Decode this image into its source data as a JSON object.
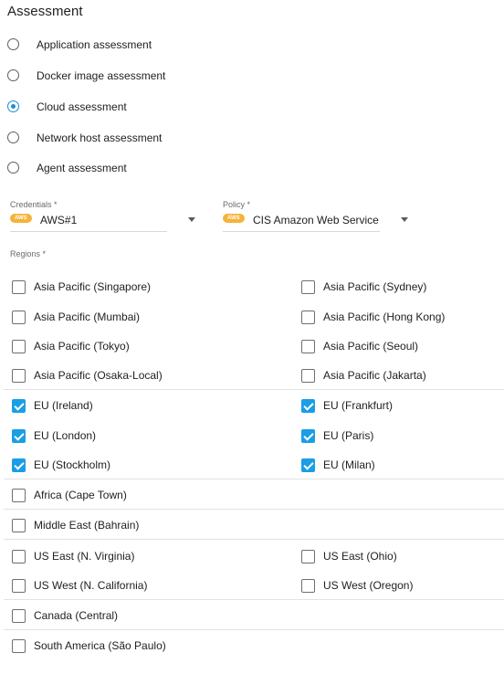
{
  "title": "Assessment",
  "assessment_types": [
    {
      "label": "Application assessment",
      "selected": false
    },
    {
      "label": "Docker image assessment",
      "selected": false
    },
    {
      "label": "Cloud assessment",
      "selected": true
    },
    {
      "label": "Network host assessment",
      "selected": false
    },
    {
      "label": "Agent assessment",
      "selected": false
    }
  ],
  "credentials": {
    "label": "Credentials *",
    "badge": "AWS",
    "value": "AWS#1"
  },
  "policy": {
    "label": "Policy *",
    "badge": "AWS",
    "value": "CIS Amazon Web Services"
  },
  "regions": {
    "label": "Regions *",
    "items": [
      {
        "label": "Asia Pacific (Singapore)",
        "checked": false
      },
      {
        "label": "Asia Pacific (Sydney)",
        "checked": false
      },
      {
        "label": "Asia Pacific (Mumbai)",
        "checked": false
      },
      {
        "label": "Asia Pacific (Hong Kong)",
        "checked": false
      },
      {
        "label": "Asia Pacific (Tokyo)",
        "checked": false
      },
      {
        "label": "Asia Pacific (Seoul)",
        "checked": false
      },
      {
        "label": "Asia Pacific (Osaka-Local)",
        "checked": false
      },
      {
        "label": "Asia Pacific (Jakarta)",
        "checked": false
      },
      {
        "label": "EU (Ireland)",
        "checked": true
      },
      {
        "label": "EU (Frankfurt)",
        "checked": true
      },
      {
        "label": "EU (London)",
        "checked": true
      },
      {
        "label": "EU (Paris)",
        "checked": true
      },
      {
        "label": "EU (Stockholm)",
        "checked": true
      },
      {
        "label": "EU (Milan)",
        "checked": true
      },
      {
        "label": "Africa (Cape Town)",
        "checked": false
      },
      {
        "label": "Middle East (Bahrain)",
        "checked": false
      },
      {
        "label": "US East (N. Virginia)",
        "checked": false
      },
      {
        "label": "US East (Ohio)",
        "checked": false
      },
      {
        "label": "US West (N. California)",
        "checked": false
      },
      {
        "label": "US West (Oregon)",
        "checked": false
      },
      {
        "label": "Canada (Central)",
        "checked": false
      },
      {
        "label": "South America (São Paulo)",
        "checked": false
      }
    ]
  },
  "colors": {
    "accent": "#1a9ee6",
    "aws_badge": "#f4b43a"
  }
}
